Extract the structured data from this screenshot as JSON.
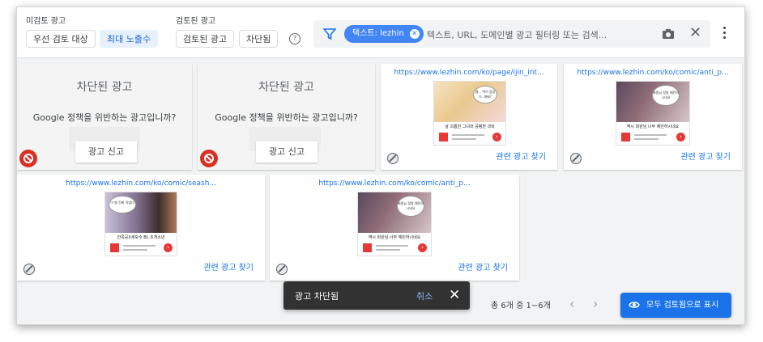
{
  "toolbar": {
    "unreviewed_label": "미검토 광고",
    "priority_review_chip": "우선 검토 대상",
    "max_exposure_chip": "최대 노출수",
    "reviewed_label": "검토된 광고",
    "reviewed_ads_chip": "검토된 광고",
    "blocked_chip": "차단됨",
    "help_glyph": "?"
  },
  "filter": {
    "chip_label": "텍스트: lezhin",
    "chip_remove_glyph": "✕",
    "search_placeholder": "텍스트, URL, 도메인별 광고 필터링 또는 검색...",
    "clear_glyph": "✕"
  },
  "blocked_card": {
    "title": "차단된 광고",
    "question": "Google 정책을 위반하는 광고입니까?",
    "report_label": "광고 신고"
  },
  "ads": [
    {
      "url": "https://www.lezhin.com/ko/page/ijin_int...",
      "caption": "날 괴롭힌 그녀와 공평한 과외",
      "bubble": "쌤... 떡이 잡았다. 쩌쩌?",
      "find_label": "관련 광고 찾기"
    },
    {
      "url": "https://www.lezhin.com/ko/comic/anti_p...",
      "caption": "역시 회원님 너무 예민하시네요",
      "bubble": "회원님 정말 예민하시네요",
      "find_label": "관련 광고 찾기"
    },
    {
      "url": "https://www.lezhin.com/ko/comic/seash...",
      "caption": "안쪽공X세모수 BL 조개소년",
      "bubble": "이 형 진짜 귀엽다",
      "find_label": "관련 광고 찾기"
    },
    {
      "url": "https://www.lezhin.com/ko/comic/anti_p...",
      "caption": "역시 회원님 너무 예민하시네요",
      "bubble": "회원님 정말 예민하시네요",
      "find_label": "관련 광고 찾기"
    }
  ],
  "toast": {
    "message": "광고 차단됨",
    "undo_label": "취소",
    "close_glyph": "✕"
  },
  "pagination": {
    "count_text": "총 6개 중 1~6개",
    "prev_glyph": "‹",
    "next_glyph": "›"
  },
  "review_all_label": "모두 검토됨으로 표시",
  "colors": {
    "accent": "#1a73e8",
    "filter_chip": "#4285f4",
    "block_red": "#d93025",
    "toast_bg": "#323232"
  }
}
